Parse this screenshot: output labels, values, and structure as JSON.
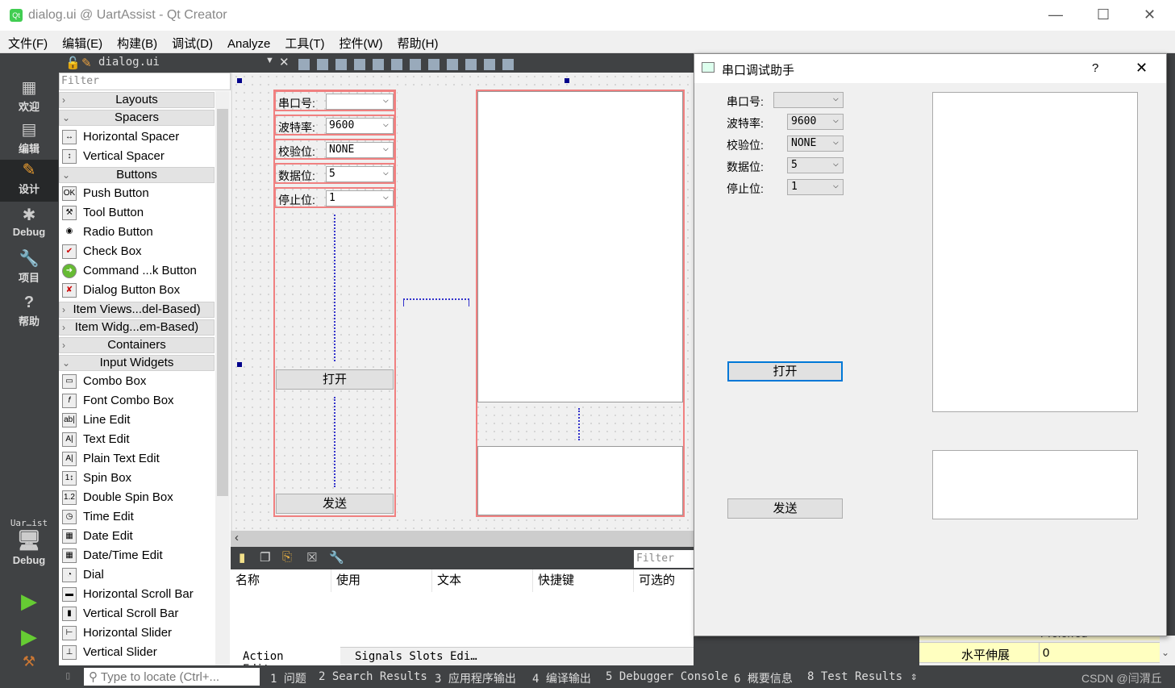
{
  "window": {
    "title": "dialog.ui @ UartAssist - Qt Creator",
    "app_icon": "Qt"
  },
  "menu": [
    "文件(F)",
    "编辑(E)",
    "构建(B)",
    "调试(D)",
    "Analyze",
    "工具(T)",
    "控件(W)",
    "帮助(H)"
  ],
  "editor_toolbar": {
    "file": "dialog.ui"
  },
  "modes": [
    {
      "label": "欢迎",
      "icon": "grid-icon"
    },
    {
      "label": "编辑",
      "icon": "edit-icon"
    },
    {
      "label": "设计",
      "icon": "pencil-icon"
    },
    {
      "label": "Debug",
      "icon": "bug-icon"
    },
    {
      "label": "项目",
      "icon": "wrench-icon"
    },
    {
      "label": "帮助",
      "icon": "help-icon"
    }
  ],
  "kit": {
    "project": "Uar…ist",
    "build": "Debug"
  },
  "widget_box": {
    "filter_placeholder": "Filter",
    "categories": {
      "layouts": "Layouts",
      "spacers": "Spacers",
      "buttons": "Buttons",
      "item_views": "Item Views...del-Based)",
      "item_widgets": "Item Widg...em-Based)",
      "containers": "Containers",
      "input_widgets": "Input Widgets"
    },
    "spacers": [
      "Horizontal Spacer",
      "Vertical Spacer"
    ],
    "buttons": [
      "Push Button",
      "Tool Button",
      "Radio Button",
      "Check Box",
      "Command ...k Button",
      "Dialog Button Box"
    ],
    "inputs": [
      "Combo Box",
      "Font Combo Box",
      "Line Edit",
      "Text Edit",
      "Plain Text Edit",
      "Spin Box",
      "Double Spin Box",
      "Time Edit",
      "Date Edit",
      "Date/Time Edit",
      "Dial",
      "Horizontal Scroll Bar",
      "Vertical Scroll Bar",
      "Horizontal Slider",
      "Vertical Slider"
    ]
  },
  "form": {
    "rows": [
      {
        "label": "串口号:",
        "value": ""
      },
      {
        "label": "波特率:",
        "value": "9600"
      },
      {
        "label": "校验位:",
        "value": "NONE"
      },
      {
        "label": "数据位:",
        "value": "5"
      },
      {
        "label": "停止位:",
        "value": "1"
      }
    ],
    "open_button": "打开",
    "send_button": "发送"
  },
  "action_editor": {
    "filter_placeholder": "Filter",
    "columns": [
      "名称",
      "使用",
      "文本",
      "快捷键",
      "可选的"
    ],
    "tabs": [
      "Action Editor",
      "Signals  Slots Edi…"
    ]
  },
  "statusbar": {
    "locate_placeholder": "Type to locate (Ctrl+...",
    "panes": [
      "1 问题",
      "2 Search Results",
      "3 应用程序输出",
      "4 编译输出",
      "5 Debugger Console",
      "6 概要信息",
      "8 Test Results"
    ],
    "watermark": "CSDN @闫渭丘"
  },
  "property": {
    "name": "水平伸展",
    "value": "0",
    "partial_above": "Preferred"
  },
  "preview": {
    "title": "串口调试助手",
    "help": "?",
    "close": "✕",
    "rows": [
      {
        "label": "串口号:",
        "value": ""
      },
      {
        "label": "波特率:",
        "value": "9600"
      },
      {
        "label": "校验位:",
        "value": "NONE"
      },
      {
        "label": "数据位:",
        "value": "5"
      },
      {
        "label": "停止位:",
        "value": "1"
      }
    ],
    "open_button": "打开",
    "send_button": "发送"
  }
}
